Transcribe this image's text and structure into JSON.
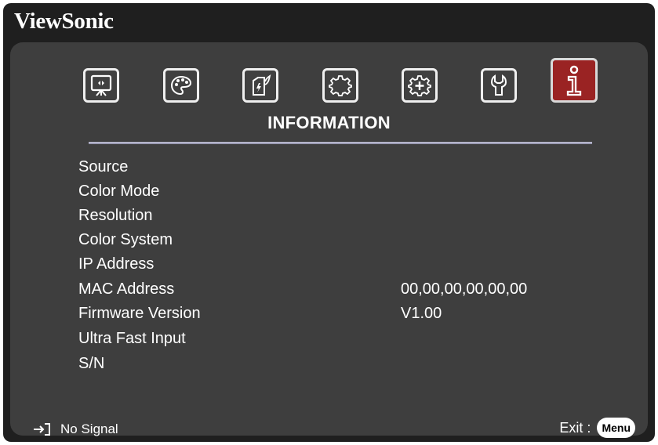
{
  "brand": "ViewSonic",
  "menu": {
    "title": "INFORMATION",
    "tabs": [
      {
        "name": "display",
        "icon": "display-icon"
      },
      {
        "name": "image",
        "icon": "palette-icon"
      },
      {
        "name": "power",
        "icon": "power-management-icon"
      },
      {
        "name": "basic",
        "icon": "basic-gear-icon"
      },
      {
        "name": "advanced",
        "icon": "advanced-gear-icon"
      },
      {
        "name": "system",
        "icon": "wrench-icon"
      },
      {
        "name": "information",
        "icon": "info-icon",
        "active": true
      }
    ]
  },
  "info": {
    "source": {
      "label": "Source",
      "value": ""
    },
    "color_mode": {
      "label": "Color Mode",
      "value": ""
    },
    "resolution": {
      "label": "Resolution",
      "value": ""
    },
    "color_system": {
      "label": "Color System",
      "value": ""
    },
    "ip_address": {
      "label": "IP Address",
      "value": ""
    },
    "mac_address": {
      "label": "MAC Address",
      "value": "00,00,00,00,00,00"
    },
    "firmware_version": {
      "label": "Firmware Version",
      "value": "V1.00"
    },
    "ultra_fast_input": {
      "label": "Ultra Fast Input",
      "value": ""
    },
    "serial_number": {
      "label": "S/N",
      "value": ""
    }
  },
  "footer": {
    "status_icon": "input-source-icon",
    "status": "No Signal",
    "exit_label": "Exit :",
    "menu_key": "Menu"
  },
  "colors": {
    "background": "#1f1f1f",
    "panel": "#3e3e3e",
    "active_tab": "#9a2323",
    "text": "#ffffff"
  }
}
